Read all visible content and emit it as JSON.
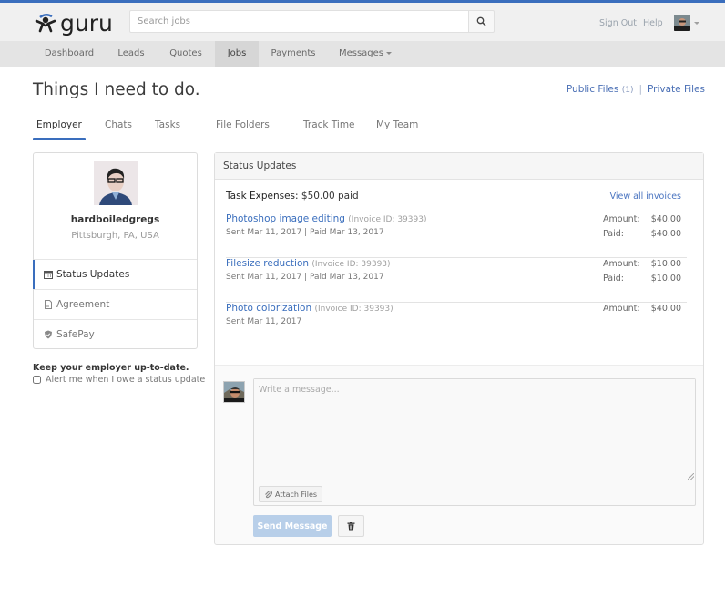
{
  "brand": {
    "name": "guru",
    "accent": "#3a6ebd"
  },
  "header": {
    "search_placeholder": "Search jobs",
    "links": [
      "Sign Out",
      "Help"
    ]
  },
  "nav": {
    "items": [
      {
        "label": "Dashboard"
      },
      {
        "label": "Leads"
      },
      {
        "label": "Quotes"
      },
      {
        "label": "Jobs",
        "active": true
      },
      {
        "label": "Payments"
      },
      {
        "label": "Messages",
        "has_dropdown": true
      }
    ]
  },
  "page": {
    "title": "Things I need to do.",
    "public_files_label": "Public Files",
    "public_files_count": "(1)",
    "separator": "|",
    "private_files_label": "Private Files"
  },
  "tabs": [
    {
      "label": "Employer",
      "active": true
    },
    {
      "label": "Chats"
    },
    {
      "label": "Tasks"
    },
    {
      "label": "File Folders"
    },
    {
      "label": "Track Time"
    },
    {
      "label": "My Team"
    }
  ],
  "profile": {
    "username": "hardboiledgregs",
    "location": "Pittsburgh, PA, USA",
    "menu": [
      {
        "label": "Status Updates",
        "icon": "calendar-icon",
        "active": true
      },
      {
        "label": "Agreement",
        "icon": "document-icon"
      },
      {
        "label": "SafePay",
        "icon": "shield-icon"
      }
    ]
  },
  "alerts": {
    "title": "Keep your employer up-to-date.",
    "checkbox_label": "Alert me when I owe a status update",
    "checked": false
  },
  "status_panel": {
    "title": "Status Updates",
    "expenses_label": "Task Expenses:",
    "expenses_value": "$50.00 paid",
    "view_all_label": "View all invoices",
    "invoices": [
      {
        "title": "Photoshop image editing",
        "invoice_id": "(Invoice ID: 39393)",
        "dates": "Sent Mar 11, 2017  | Paid Mar 13, 2017",
        "amount_label": "Amount:",
        "amount": "$40.00",
        "paid_label": "Paid:",
        "paid": "$40.00"
      },
      {
        "title": "Filesize reduction",
        "invoice_id": "(Invoice ID: 39393)",
        "dates": "Sent Mar 11, 2017  | Paid Mar 13, 2017",
        "amount_label": "Amount:",
        "amount": "$10.00",
        "paid_label": "Paid:",
        "paid": "$10.00"
      },
      {
        "title": "Photo colorization",
        "invoice_id": "(Invoice ID: 39393)",
        "dates": "Sent Mar 11, 2017",
        "amount_label": "Amount:",
        "amount": "$40.00"
      }
    ]
  },
  "composer": {
    "placeholder": "Write a message...",
    "attach_label": "Attach Files",
    "send_label": "Send Message"
  }
}
